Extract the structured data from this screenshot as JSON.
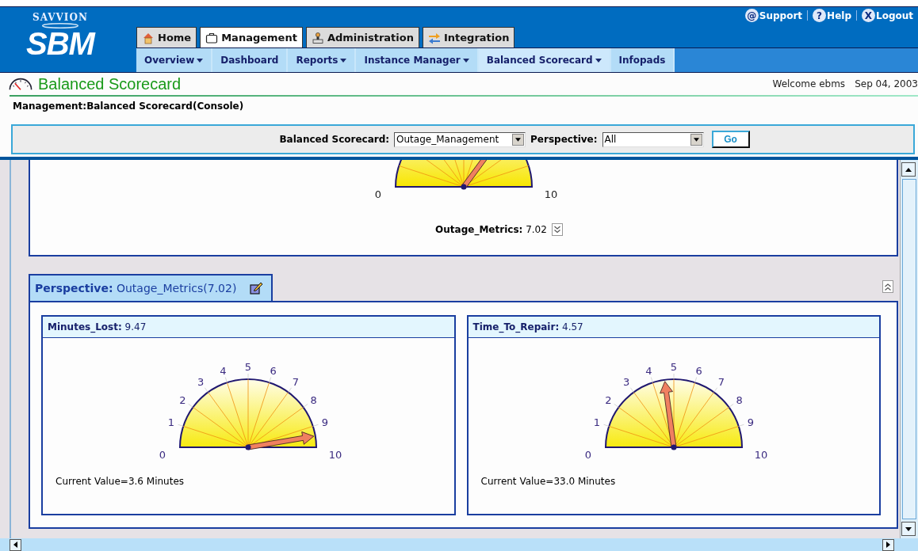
{
  "header": {
    "logo_top": "SAVVION",
    "logo_main": "SBM",
    "top_links": [
      {
        "icon": "@",
        "label": "Support"
      },
      {
        "icon": "?",
        "label": "Help"
      },
      {
        "icon": "X",
        "label": "Logout"
      }
    ],
    "tabs": [
      {
        "label": "Home",
        "kind": "home",
        "selected": false
      },
      {
        "label": "Management",
        "kind": "briefcase",
        "selected": true
      },
      {
        "label": "Administration",
        "kind": "admin",
        "selected": false
      },
      {
        "label": "Integration",
        "kind": "arrows",
        "selected": false
      }
    ],
    "subnav": [
      {
        "label": "Overview",
        "has_menu": true,
        "selected": false
      },
      {
        "label": "Dashboard",
        "has_menu": false,
        "selected": false
      },
      {
        "label": "Reports",
        "has_menu": true,
        "selected": false
      },
      {
        "label": "Instance Manager",
        "has_menu": true,
        "selected": false
      },
      {
        "label": "Balanced Scorecard",
        "has_menu": true,
        "selected": true
      },
      {
        "label": "Infopads",
        "has_menu": false,
        "selected": false
      }
    ]
  },
  "page": {
    "title": "Balanced Scorecard",
    "welcome": "Welcome ebms",
    "date": "Sep 04, 2003",
    "breadcrumb": "Management:Balanced Scorecard(Console)"
  },
  "filter": {
    "scorecard_label": "Balanced Scorecard:",
    "scorecard_value": "Outage_Management",
    "perspective_label": "Perspective:",
    "perspective_value": "All",
    "go": "Go"
  },
  "summary": {
    "ticks": [
      "0",
      "10"
    ],
    "name": "Outage_Metrics:",
    "value": "7.02"
  },
  "perspective": {
    "label": "Perspective:",
    "name": "Outage_Metrics(7.02)"
  },
  "metrics": [
    {
      "name": "Minutes_Lost:",
      "value": "9.47",
      "ticks": [
        "0",
        "1",
        "2",
        "3",
        "4",
        "5",
        "6",
        "7",
        "8",
        "9",
        "10"
      ],
      "current": "Current Value=3.6 Minutes"
    },
    {
      "name": "Time_To_Repair:",
      "value": "4.57",
      "ticks": [
        "0",
        "1",
        "2",
        "3",
        "4",
        "5",
        "6",
        "7",
        "8",
        "9",
        "10"
      ],
      "current": "Current Value=33.0 Minutes"
    }
  ]
}
